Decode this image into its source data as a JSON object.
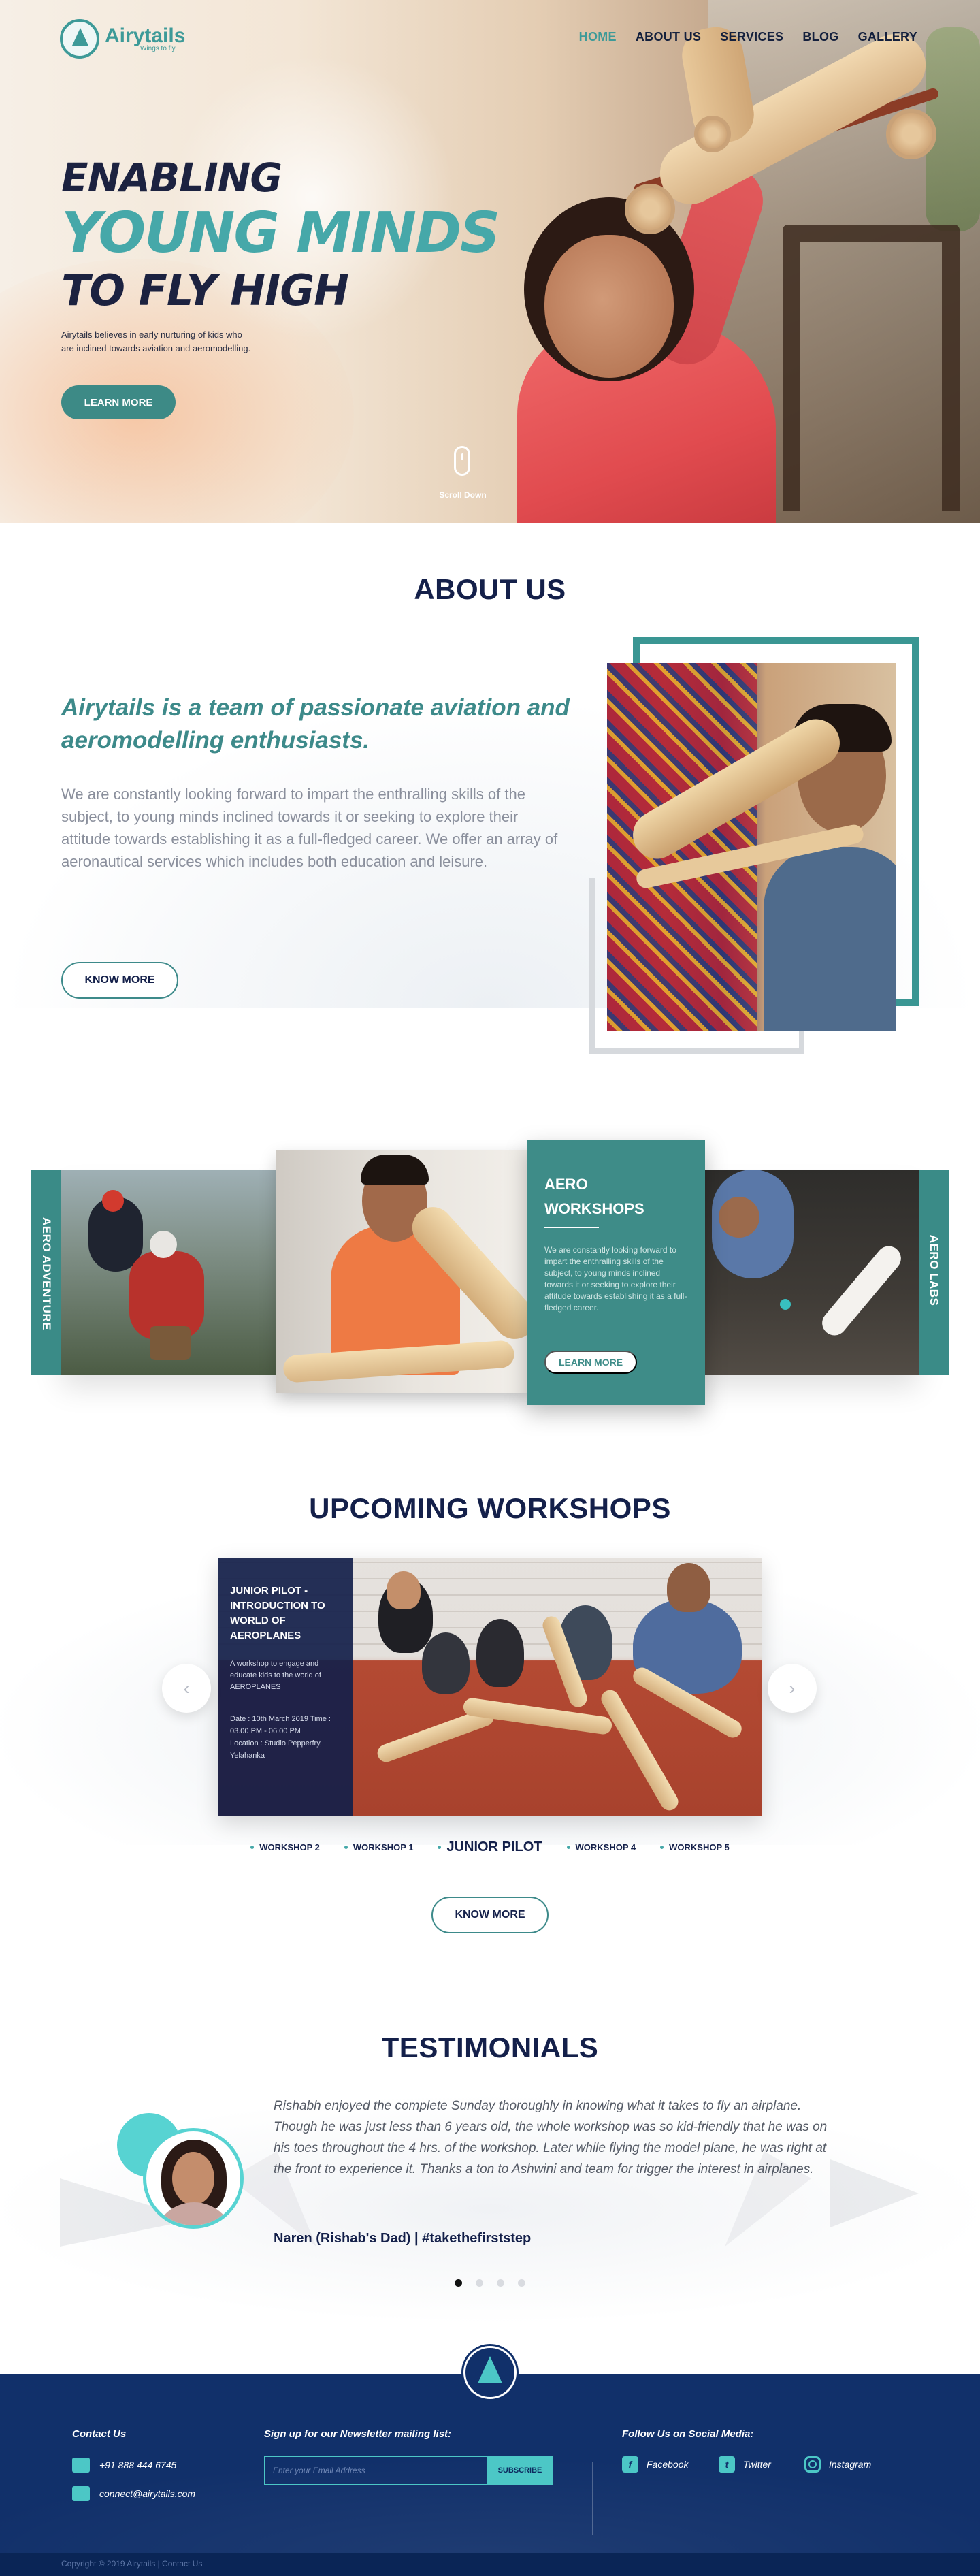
{
  "brand": {
    "name": "Airytails",
    "tagline": "Wings to fly",
    "color": "#3d9a98"
  },
  "nav": {
    "items": [
      {
        "label": "HOME",
        "active": true
      },
      {
        "label": "ABOUT US",
        "active": false
      },
      {
        "label": "SERVICES",
        "active": false
      },
      {
        "label": "BLOG",
        "active": false
      },
      {
        "label": "GALLERY",
        "active": false
      }
    ]
  },
  "hero": {
    "line1": "ENABLING",
    "line2": "YOUNG MINDS",
    "line3": "TO FLY HIGH",
    "text": "Airytails believes in early nurturing of kids who are inclined towards aviation and aeromodelling.",
    "cta": "LEARN MORE",
    "scroll": "Scroll Down"
  },
  "about": {
    "title": "ABOUT US",
    "lead": "Airytails is a team of passionate aviation and aeromodelling enthusiasts.",
    "body": "We are constantly looking forward to impart the enthralling skills of the subject, to young minds inclined towards it or seeking to explore their attitude towards establishing it as a full-fledged career. We offer an array of aeronautical services which includes both education and leisure.",
    "cta": "KNOW MORE"
  },
  "services": {
    "left_label": "AERO ADVENTURE",
    "right_label": "AERO LABS",
    "card": {
      "title": "AERO WORKSHOPS",
      "text": "We are constantly looking forward to impart the enthralling skills of the subject, to young minds inclined towards it or seeking to explore their attitude towards establishing it as a full-fledged career.",
      "cta": "LEARN MORE"
    }
  },
  "workshops": {
    "title": "UPCOMING WORKSHOPS",
    "slide": {
      "title": "JUNIOR PILOT - INTRODUCTION TO WORLD OF AEROPLANES",
      "text": "A workshop to engage and educate kids to the world of AEROPLANES",
      "date": "Date : 10th March 2019 Time : 03.00 PM - 06.00 PM",
      "location": "Location : Studio Pepperfry, Yelahanka"
    },
    "prev_icon": "‹",
    "next_icon": "›",
    "tabs": [
      {
        "label": "WORKSHOP 2",
        "active": false
      },
      {
        "label": "WORKSHOP 1",
        "active": false
      },
      {
        "label": "JUNIOR PILOT",
        "active": true
      },
      {
        "label": "WORKSHOP 4",
        "active": false
      },
      {
        "label": "WORKSHOP 5",
        "active": false
      }
    ],
    "cta": "KNOW MORE"
  },
  "testimonials": {
    "title": "TESTIMONIALS",
    "quote": "Rishabh enjoyed the complete Sunday thoroughly in knowing what it takes to fly an airplane. Though he was just less than 6 years old, the whole workshop was so kid-friendly that he was on his toes throughout the 4 hrs. of the workshop. Later while flying the model plane, he was right at the front to experience it. Thanks a ton to Ashwini and team for trigger the interest in airplanes.",
    "author": "Naren (Rishab's Dad) | #takethefirststep",
    "active_index": 0,
    "count": 4
  },
  "footer": {
    "contact_title": "Contact Us",
    "phone": "+91 888 444 6745",
    "email": "connect@airytails.com",
    "newsletter_title": "Sign up for our Newsletter mailing list:",
    "email_placeholder": "Enter your Email Address",
    "subscribe": "SUBSCRIBE",
    "social_title": "Follow Us on Social Media:",
    "social": [
      "Facebook",
      "Twitter",
      "Instagram"
    ],
    "copyright": "Copyright © 2019 Airytails | Contact Us"
  },
  "colors": {
    "teal": "#3d8a86",
    "navy": "#14204a",
    "footer": "#11306a",
    "accent": "#4cc7c6"
  }
}
